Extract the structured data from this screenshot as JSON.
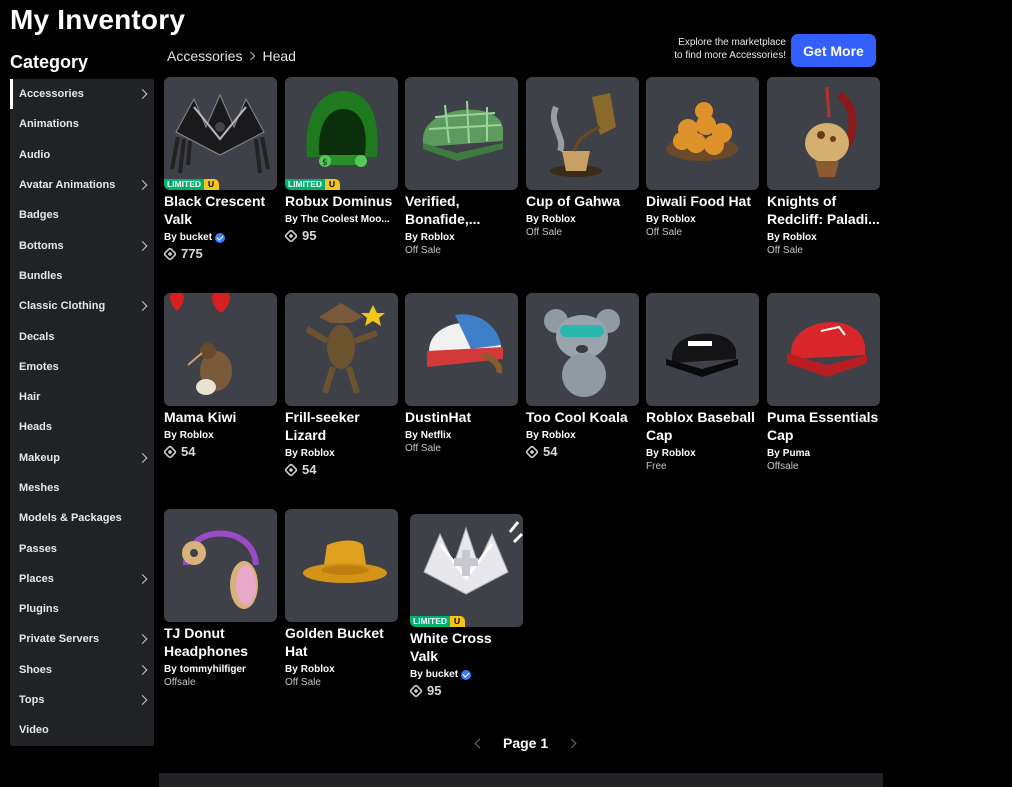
{
  "page_title": "My Inventory",
  "category_heading": "Category",
  "sidebar": {
    "items": [
      {
        "label": "Accessories",
        "arrow": true,
        "active": true
      },
      {
        "label": "Animations",
        "arrow": false
      },
      {
        "label": "Audio",
        "arrow": false
      },
      {
        "label": "Avatar Animations",
        "arrow": true
      },
      {
        "label": "Badges",
        "arrow": false
      },
      {
        "label": "Bottoms",
        "arrow": true
      },
      {
        "label": "Bundles",
        "arrow": false
      },
      {
        "label": "Classic Clothing",
        "arrow": true
      },
      {
        "label": "Decals",
        "arrow": false
      },
      {
        "label": "Emotes",
        "arrow": false
      },
      {
        "label": "Hair",
        "arrow": false
      },
      {
        "label": "Heads",
        "arrow": false
      },
      {
        "label": "Makeup",
        "arrow": true
      },
      {
        "label": "Meshes",
        "arrow": false
      },
      {
        "label": "Models & Packages",
        "arrow": false
      },
      {
        "label": "Passes",
        "arrow": false
      },
      {
        "label": "Places",
        "arrow": true
      },
      {
        "label": "Plugins",
        "arrow": false
      },
      {
        "label": "Private Servers",
        "arrow": true
      },
      {
        "label": "Shoes",
        "arrow": true
      },
      {
        "label": "Tops",
        "arrow": true
      },
      {
        "label": "Video",
        "arrow": false
      }
    ]
  },
  "breadcrumb": {
    "parent": "Accessories",
    "current": "Head"
  },
  "promo": {
    "line1": "Explore the marketplace",
    "line2": "to find more Accessories!",
    "button": "Get More"
  },
  "items": [
    {
      "name": "Black Crescent Valk",
      "by": "By",
      "creator": "bucket",
      "verified": true,
      "price": "775",
      "status": "",
      "limited": true,
      "icon": "black-crescent-valk-thumbnail"
    },
    {
      "name": "Robux Dominus",
      "by": "By",
      "creator": "The Coolest Moo...",
      "verified": false,
      "price": "95",
      "status": "",
      "limited": true,
      "icon": "robux-dominus-thumbnail"
    },
    {
      "name": "Verified, Bonafide,...",
      "by": "By",
      "creator": "Roblox",
      "verified": false,
      "price": "",
      "status": "Off Sale",
      "limited": false,
      "icon": "plaid-cap-thumbnail"
    },
    {
      "name": "Cup of Gahwa",
      "by": "By",
      "creator": "Roblox",
      "verified": false,
      "price": "",
      "status": "Off Sale",
      "limited": false,
      "icon": "coffee-pot-thumbnail"
    },
    {
      "name": "Diwali Food Hat",
      "by": "By",
      "creator": "Roblox",
      "verified": false,
      "price": "",
      "status": "Off Sale",
      "limited": false,
      "icon": "food-platter-thumbnail"
    },
    {
      "name": "Knights of Redcliff: Paladi...",
      "by": "By",
      "creator": "Roblox",
      "verified": false,
      "price": "",
      "status": "Off Sale",
      "limited": false,
      "icon": "knight-helmet-thumbnail"
    },
    {
      "name": "Mama Kiwi",
      "by": "By",
      "creator": "Roblox",
      "verified": false,
      "price": "54",
      "status": "",
      "limited": false,
      "icon": "kiwi-bird-thumbnail"
    },
    {
      "name": "Frill-seeker Lizard",
      "by": "By",
      "creator": "Roblox",
      "verified": false,
      "price": "54",
      "status": "",
      "limited": false,
      "icon": "lizard-thumbnail"
    },
    {
      "name": "DustinHat",
      "by": "By",
      "creator": "Netflix",
      "verified": false,
      "price": "",
      "status": "Off Sale",
      "limited": false,
      "icon": "trucker-cap-thumbnail"
    },
    {
      "name": "Too Cool Koala",
      "by": "By",
      "creator": "Roblox",
      "verified": false,
      "price": "54",
      "status": "",
      "limited": false,
      "icon": "koala-thumbnail"
    },
    {
      "name": "Roblox Baseball Cap",
      "by": "By",
      "creator": "Roblox",
      "verified": false,
      "price": "",
      "status": "Free",
      "limited": false,
      "icon": "black-baseball-cap-thumbnail"
    },
    {
      "name": "Puma Essentials Cap",
      "by": "By",
      "creator": "Puma",
      "verified": false,
      "price": "",
      "status": "Offsale",
      "limited": false,
      "icon": "red-cap-thumbnail"
    },
    {
      "name": "TJ Donut Headphones",
      "by": "By",
      "creator": "tommyhilfiger",
      "verified": false,
      "price": "",
      "status": "Offsale",
      "limited": false,
      "icon": "donut-headphones-thumbnail"
    },
    {
      "name": "Golden Bucket Hat",
      "by": "By",
      "creator": "Roblox",
      "verified": false,
      "price": "",
      "status": "Off Sale",
      "limited": false,
      "icon": "bucket-hat-thumbnail"
    },
    {
      "name": "White Cross Valk",
      "by": "By",
      "creator": "bucket",
      "verified": true,
      "price": "95",
      "status": "",
      "limited": true,
      "icon": "white-cross-valk-thumbnail"
    }
  ],
  "limited_badge": {
    "label": "LIMITED",
    "unique": "U"
  },
  "pagination": {
    "label": "Page 1"
  },
  "colors": {
    "accent": "#335fff",
    "limited": "#00b06f",
    "unique": "#f5c518",
    "panel": "#202226",
    "thumb_bg": "#3f4148"
  }
}
